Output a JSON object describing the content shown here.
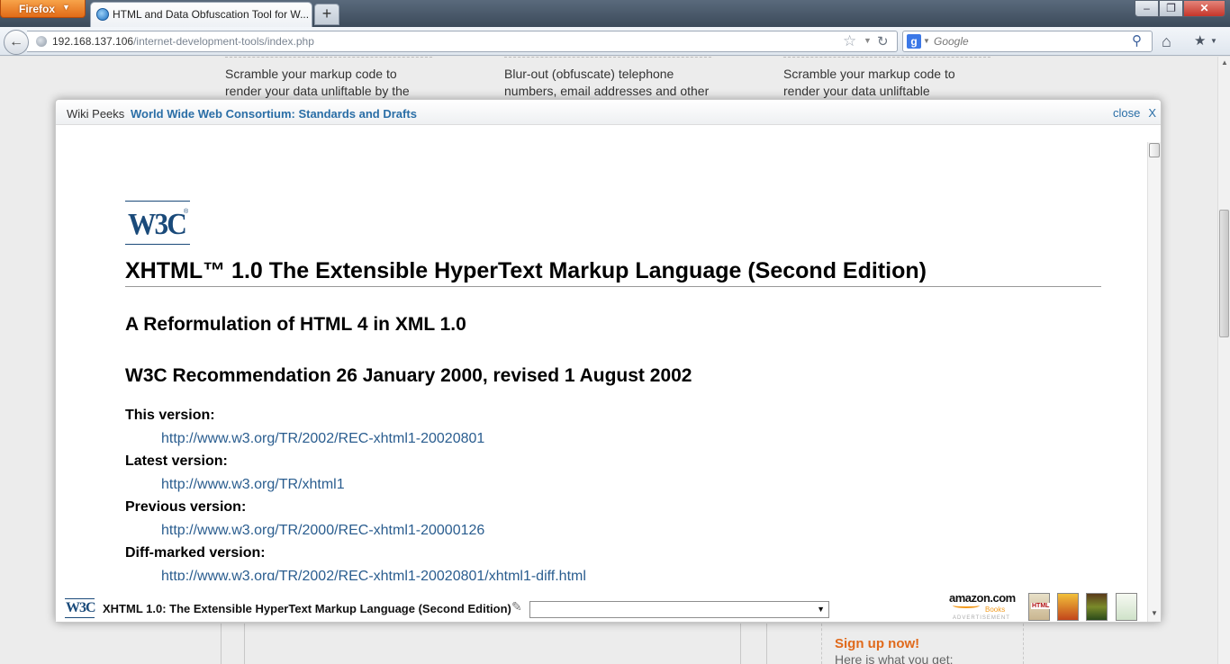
{
  "browser": {
    "menu_button": "Firefox",
    "tab_title": "HTML and Data Obfuscation Tool for W...",
    "new_tab": "+",
    "url_host": "192.168.137.106",
    "url_path": "/internet-development-tools/index.php",
    "search_placeholder": "Google",
    "window_buttons": {
      "minimize": "–",
      "maximize": "❐",
      "close": "✕"
    }
  },
  "page": {
    "teasers": [
      "Scramble your markup code to render your data unliftable by the",
      "Blur-out (obfuscate) telephone numbers, email addresses and other",
      "Scramble your markup code to render your data unliftable"
    ],
    "signup_link": "Sign up now!",
    "signup_sub": "Here is what you get:"
  },
  "overlay": {
    "label": "Wiki Peeks",
    "title": "World Wide Web Consortium: Standards and Drafts",
    "close_label": "close",
    "close_x": "X"
  },
  "document": {
    "logo_text": "W3C",
    "logo_reg": "®",
    "title": "XHTML™ 1.0 The Extensible HyperText Markup Language (Second Edition)",
    "subtitle": "A Reformulation of HTML 4 in XML 1.0",
    "status": "W3C Recommendation 26 January 2000, revised 1 August 2002",
    "versions": [
      {
        "label": "This version:",
        "url": "http://www.w3.org/TR/2002/REC-xhtml1-20020801"
      },
      {
        "label": "Latest version:",
        "url": "http://www.w3.org/TR/xhtml1"
      },
      {
        "label": "Previous version:",
        "url": "http://www.w3.org/TR/2000/REC-xhtml1-20000126"
      },
      {
        "label": "Diff-marked version:",
        "url": "http://www.w3.org/TR/2002/REC-xhtml1-20020801/xhtml1-diff.html"
      }
    ]
  },
  "footer": {
    "logo_text": "W3C",
    "title": "XHTML 1.0: The Extensible HyperText Markup Language (Second Edition)",
    "amazon": "amazon.com",
    "amazon_books": "Books",
    "amazon_adv": "ADVERTISEMENT",
    "book1_label": "HTML"
  },
  "icons": {
    "back": "back-arrow-icon",
    "site": "globe-icon",
    "bookmark": "star-icon",
    "reload": "reload-icon",
    "search_engine": "google-icon",
    "search": "magnifier-icon",
    "home": "home-icon",
    "bookmarks_menu": "bookmarks-icon",
    "attachment": "paperclip-icon"
  },
  "colors": {
    "link": "#2a5d8f",
    "overlay_title": "#2a6ea6",
    "firefox_button": "#e26b17",
    "signup": "#e06a1c",
    "w3c_blue": "#1a4a7a"
  }
}
